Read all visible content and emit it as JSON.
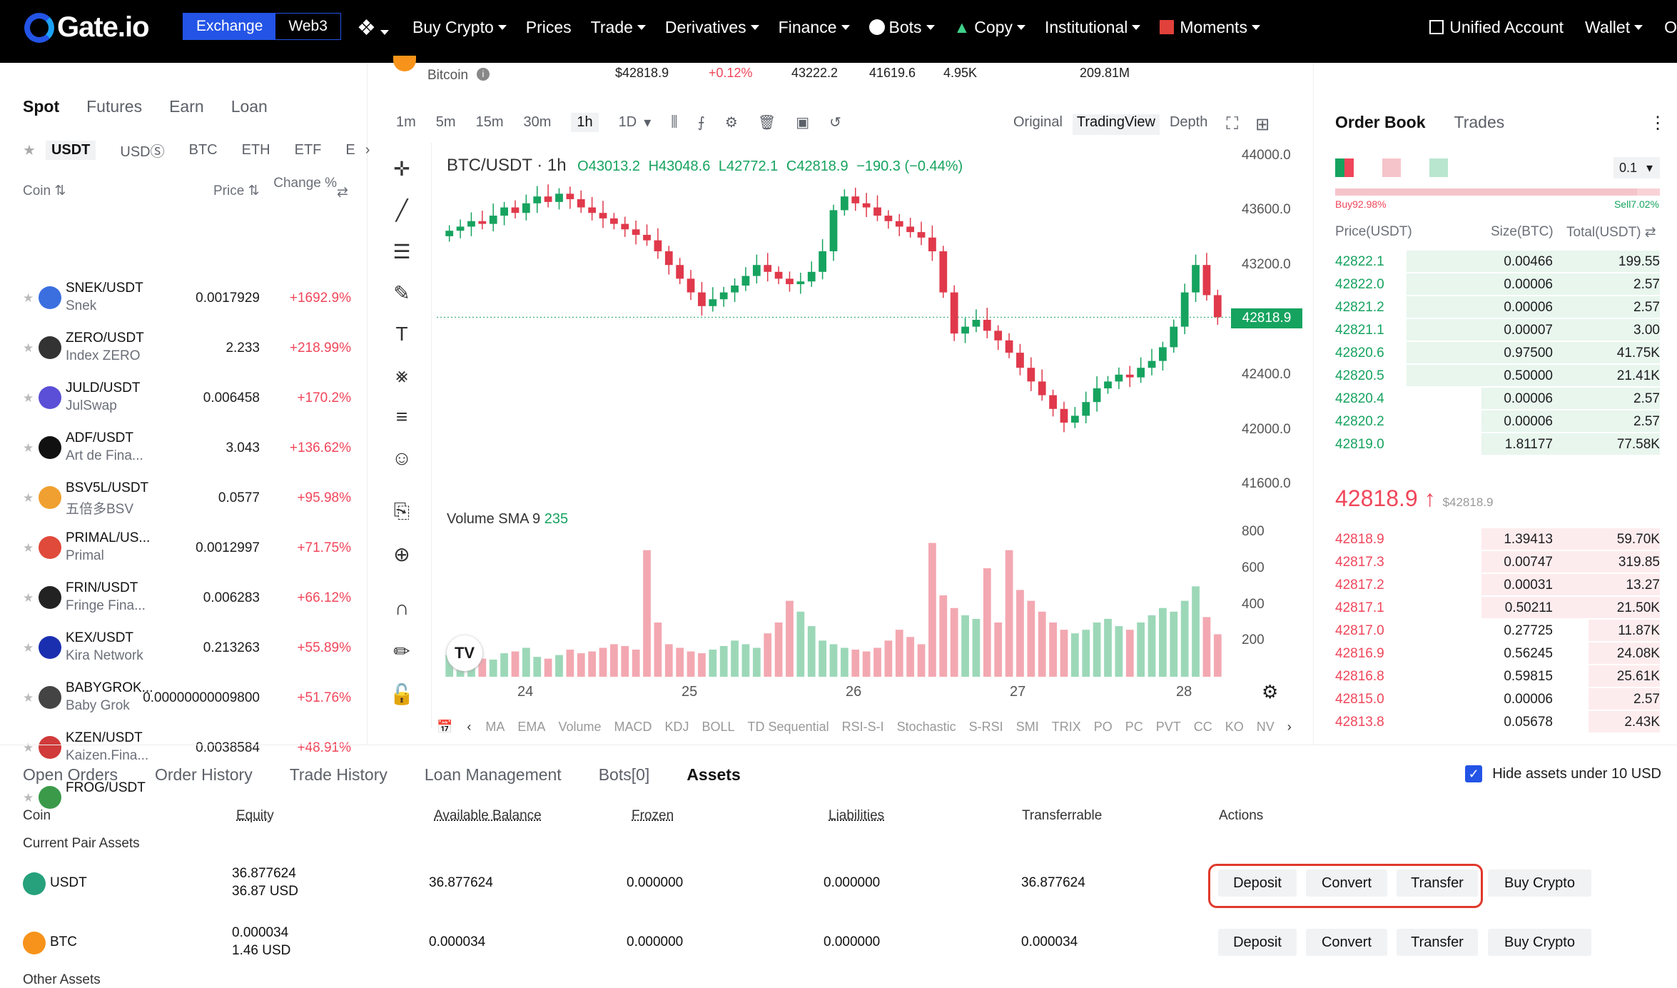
{
  "topnav": {
    "brand": "Gate.io",
    "mode_exchange": "Exchange",
    "mode_web3": "Web3",
    "items": [
      "Buy Crypto",
      "Prices",
      "Trade",
      "Derivatives",
      "Finance",
      "Bots",
      "Copy",
      "Institutional",
      "Moments"
    ],
    "unified_account": "Unified Account",
    "wallet": "Wallet",
    "overflow": "O"
  },
  "ticker": {
    "name": "Bitcoin",
    "last": "$42818.9",
    "change": "+0.12%",
    "high": "43222.2",
    "low": "41619.6",
    "volume": "4.95K",
    "turnover": "209.81M"
  },
  "market": {
    "tabs": [
      "Spot",
      "Futures",
      "Earn",
      "Loan"
    ],
    "quotes": [
      "USDT",
      "USDⓈ",
      "BTC",
      "ETH",
      "ETF",
      "E"
    ],
    "col_coin": "Coin",
    "col_price": "Price",
    "col_change": "Change %",
    "rows": [
      {
        "pair": "SNEK/USDT",
        "name": "Snek",
        "price": "0.0017929",
        "change": "+1692.9%",
        "color": "#3b6fe0"
      },
      {
        "pair": "ZERO/USDT",
        "name": "Index ZERO",
        "price": "2.233",
        "change": "+218.99%",
        "color": "#333333"
      },
      {
        "pair": "JULD/USDT",
        "name": "JulSwap",
        "price": "0.006458",
        "change": "+170.2%",
        "color": "#5a4fd6"
      },
      {
        "pair": "ADF/USDT",
        "name": "Art de Fina...",
        "price": "3.043",
        "change": "+136.62%",
        "color": "#111111"
      },
      {
        "pair": "BSV5L/USDT",
        "name": "五倍多BSV",
        "price": "0.0577",
        "change": "+95.98%",
        "color": "#f0a030"
      },
      {
        "pair": "PRIMAL/US...",
        "name": "Primal",
        "price": "0.0012997",
        "change": "+71.75%",
        "color": "#e04a3a"
      },
      {
        "pair": "FRIN/USDT",
        "name": "Fringe Fina...",
        "price": "0.006283",
        "change": "+66.12%",
        "color": "#222222"
      },
      {
        "pair": "KEX/USDT",
        "name": "Kira Network",
        "price": "0.213263",
        "change": "+55.89%",
        "color": "#1a2fb0"
      },
      {
        "pair": "BABYGROK...",
        "name": "Baby Grok",
        "price": "0.00000000009800",
        "change": "+51.76%",
        "color": "#444444"
      },
      {
        "pair": "KZEN/USDT",
        "name": "Kaizen.Fina...",
        "price": "0.0038584",
        "change": "+48.91%",
        "color": "#d03a3a"
      },
      {
        "pair": "FROG/USDT",
        "name": "",
        "price": "",
        "change": "",
        "color": "#3a9a4a"
      }
    ]
  },
  "chart_toolbar": {
    "timeframes": [
      "1m",
      "5m",
      "15m",
      "30m",
      "1h",
      "1D"
    ],
    "active": "1h",
    "views": [
      "Original",
      "TradingView",
      "Depth"
    ]
  },
  "chart_data": {
    "type": "candlestick",
    "title": "BTC/USDT · 1h",
    "ohlc_label": {
      "O": "O43013.2",
      "H": "H43048.6",
      "L": "L42772.1",
      "C": "C42818.9",
      "chg": "−190.3 (−0.44%)"
    },
    "y_ticks": [
      "44000.0",
      "43600.0",
      "43200.0",
      "42800.0",
      "42400.0",
      "42000.0",
      "41600.0"
    ],
    "y_values": [
      44000,
      43600,
      43200,
      42800,
      42400,
      42000,
      41600
    ],
    "ylim": [
      41550,
      44050
    ],
    "last_price": "42818.9",
    "x_ticks": [
      "24",
      "25",
      "26",
      "27",
      "28"
    ],
    "volume_label": "Volume SMA 9",
    "volume_value": "235",
    "vol_ticks": [
      "800",
      "600",
      "400",
      "200"
    ],
    "vol_values": [
      800,
      600,
      400,
      200
    ],
    "vol_ylim": [
      0,
      900
    ],
    "close": [
      43450,
      43480,
      43520,
      43500,
      43560,
      43620,
      43580,
      43650,
      43700,
      43660,
      43720,
      43680,
      43620,
      43580,
      43540,
      43500,
      43460,
      43420,
      43380,
      43300,
      43200,
      43100,
      43000,
      42900,
      42950,
      43000,
      43050,
      43120,
      43200,
      43150,
      43100,
      43060,
      43080,
      43150,
      43300,
      43600,
      43700,
      43650,
      43620,
      43560,
      43520,
      43480,
      43440,
      43400,
      43300,
      43000,
      42700,
      42750,
      42800,
      42720,
      42650,
      42560,
      42450,
      42350,
      42250,
      42150,
      42050,
      42100,
      42200,
      42300,
      42350,
      42400,
      42380,
      42450,
      42500,
      42600,
      42750,
      43000,
      43200,
      42980,
      42818.9
    ],
    "volume": [
      120,
      90,
      110,
      100,
      95,
      130,
      140,
      160,
      110,
      100,
      120,
      150,
      130,
      140,
      160,
      180,
      170,
      150,
      700,
      300,
      180,
      160,
      140,
      130,
      150,
      170,
      200,
      180,
      160,
      240,
      300,
      420,
      360,
      280,
      200,
      180,
      160,
      150,
      140,
      160,
      200,
      260,
      220,
      180,
      740,
      450,
      380,
      340,
      320,
      600,
      300,
      700,
      480,
      420,
      360,
      300,
      260,
      240,
      260,
      300,
      320,
      280,
      260,
      300,
      340,
      380,
      360,
      420,
      500,
      330,
      235
    ],
    "indicators": [
      "MA",
      "EMA",
      "Volume",
      "MACD",
      "KDJ",
      "BOLL",
      "TD Sequential",
      "RSI-S-I",
      "Stochastic",
      "S-RSI",
      "SMI",
      "TRIX",
      "PO",
      "PC",
      "PVT",
      "CC",
      "KO",
      "NV"
    ]
  },
  "orderbook": {
    "tabs": [
      "Order Book",
      "Trades"
    ],
    "precision": "0.1",
    "buy_ratio": "Buy92.98%",
    "sell_ratio": "Sell7.02%",
    "col_price": "Price(USDT)",
    "col_size": "Size(BTC)",
    "col_total": "Total(USDT)",
    "bids": [
      {
        "p": "42822.1",
        "s": "0.00466",
        "t": "199.55",
        "depth": 0.78
      },
      {
        "p": "42822.0",
        "s": "0.00006",
        "t": "2.57",
        "depth": 0.78
      },
      {
        "p": "42821.2",
        "s": "0.00006",
        "t": "2.57",
        "depth": 0.78
      },
      {
        "p": "42821.1",
        "s": "0.00007",
        "t": "3.00",
        "depth": 0.78
      },
      {
        "p": "42820.6",
        "s": "0.97500",
        "t": "41.75K",
        "depth": 0.78
      },
      {
        "p": "42820.5",
        "s": "0.50000",
        "t": "21.41K",
        "depth": 0.78
      },
      {
        "p": "42820.4",
        "s": "0.00006",
        "t": "2.57",
        "depth": 0.55
      },
      {
        "p": "42820.2",
        "s": "0.00006",
        "t": "2.57",
        "depth": 0.55
      },
      {
        "p": "42819.0",
        "s": "1.81177",
        "t": "77.58K",
        "depth": 0.55
      }
    ],
    "mid_price": "42818.9",
    "mid_arrow": "↑",
    "mid_usd": "$42818.9",
    "asks": [
      {
        "p": "42818.9",
        "s": "1.39413",
        "t": "59.70K",
        "depth": 0.55
      },
      {
        "p": "42817.3",
        "s": "0.00747",
        "t": "319.85",
        "depth": 0.55
      },
      {
        "p": "42817.2",
        "s": "0.00031",
        "t": "13.27",
        "depth": 0.55
      },
      {
        "p": "42817.1",
        "s": "0.50211",
        "t": "21.50K",
        "depth": 0.55
      },
      {
        "p": "42817.0",
        "s": "0.27725",
        "t": "11.87K",
        "depth": 0.22
      },
      {
        "p": "42816.9",
        "s": "0.56245",
        "t": "24.08K",
        "depth": 0.22
      },
      {
        "p": "42816.8",
        "s": "0.59815",
        "t": "25.61K",
        "depth": 0.22
      },
      {
        "p": "42815.0",
        "s": "0.00006",
        "t": "2.57",
        "depth": 0.22
      },
      {
        "p": "42813.8",
        "s": "0.05678",
        "t": "2.43K",
        "depth": 0.22
      }
    ]
  },
  "bottom": {
    "tabs": [
      "Open Orders",
      "Order History",
      "Trade History",
      "Loan Management",
      "Bots[0]",
      "Assets"
    ],
    "active": "Assets",
    "hide_small": "Hide assets under 10 USD",
    "headers": {
      "coin": "Coin",
      "equity": "Equity",
      "available": "Available Balance",
      "frozen": "Frozen",
      "liabilities": "Liabilities",
      "transferrable": "Transferrable",
      "actions": "Actions"
    },
    "current_pair": "Current Pair Assets",
    "other_assets": "Other Assets",
    "assets": [
      {
        "coin": "USDT",
        "equity": "36.877624",
        "equity_usd": "36.87 USD",
        "available": "36.877624",
        "frozen": "0.000000",
        "liabilities": "0.000000",
        "transferrable": "36.877624",
        "color": "#26a17b"
      },
      {
        "coin": "BTC",
        "equity": "0.000034",
        "equity_usd": "1.46 USD",
        "available": "0.000034",
        "frozen": "0.000000",
        "liabilities": "0.000000",
        "transferrable": "0.000034",
        "color": "#f7931a"
      }
    ],
    "actions": {
      "deposit": "Deposit",
      "convert": "Convert",
      "transfer": "Transfer",
      "buy": "Buy Crypto"
    }
  }
}
